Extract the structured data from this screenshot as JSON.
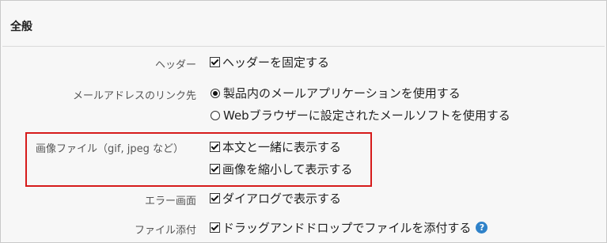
{
  "section": {
    "title": "全般"
  },
  "settings": {
    "header": {
      "label": "ヘッダー",
      "option": {
        "label": "ヘッダーを固定する",
        "checked": true
      }
    },
    "mail_link": {
      "label": "メールアドレスのリンク先",
      "options": [
        {
          "label": "製品内のメールアプリケーションを使用する",
          "selected": true
        },
        {
          "label": "Webブラウザーに設定されたメールソフトを使用する",
          "selected": false
        }
      ]
    },
    "image_file": {
      "label": "画像ファイル（gif, jpeg など）",
      "options": [
        {
          "label": "本文と一緒に表示する",
          "checked": true
        },
        {
          "label": "画像を縮小して表示する",
          "checked": true
        }
      ]
    },
    "error_screen": {
      "label": "エラー画面",
      "option": {
        "label": "ダイアログで表示する",
        "checked": true
      }
    },
    "attachment": {
      "label": "ファイル添付",
      "option": {
        "label": "ドラッグアンドドロップでファイルを添付する",
        "checked": true
      },
      "help_icon": "question-icon",
      "help_glyph": "?"
    }
  },
  "colors": {
    "highlight_border": "#d61b1b",
    "help_icon": "#2f82c9",
    "background": "#f7f7f7"
  }
}
